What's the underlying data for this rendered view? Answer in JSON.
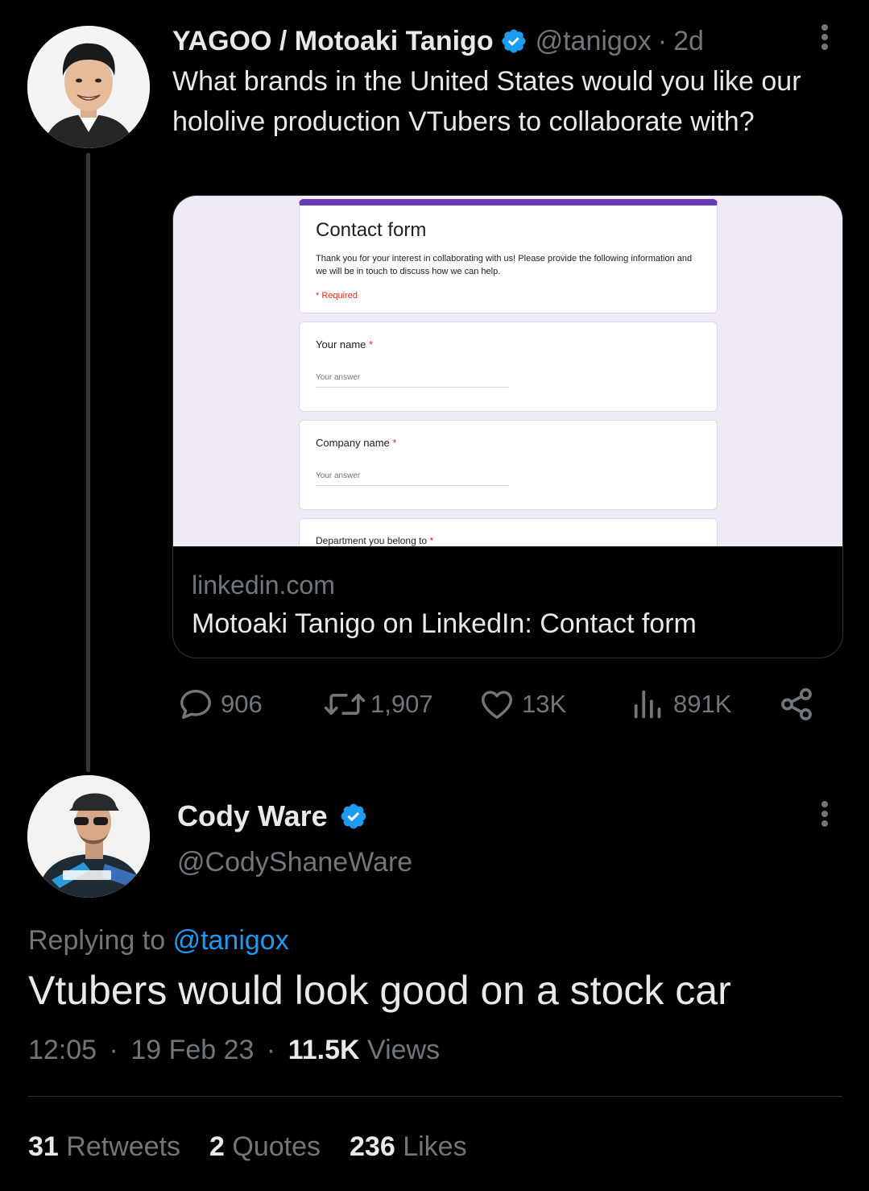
{
  "tweet": {
    "display_name": "YAGOO / Motoaki Tanigo",
    "handle": "@tanigox",
    "separator": "·",
    "age": "2d",
    "text": "What brands in the United States would you like our hololive production VTubers to collaborate with?",
    "card": {
      "form_title": "Contact form",
      "form_description": "Thank you for your interest in collaborating with us! Please provide the following information and we will be in touch to discuss how we can help.",
      "required_note": "* Required",
      "questions": [
        {
          "label": "Your name",
          "placeholder": "Your answer"
        },
        {
          "label": "Company name",
          "placeholder": "Your answer"
        },
        {
          "label": "Department you belong to",
          "placeholder": ""
        }
      ],
      "required_star": "*",
      "domain": "linkedin.com",
      "title": "Motoaki Tanigo on LinkedIn: Contact form"
    },
    "actions": {
      "replies": "906",
      "retweets": "1,907",
      "likes": "13K",
      "views": "891K"
    }
  },
  "reply": {
    "display_name": "Cody Ware",
    "handle": "@CodyShaneWare",
    "replying_prefix": "Replying to",
    "replying_to": "@tanigox",
    "text": "Vtubers would look good on a stock car",
    "time": "12:05",
    "date": "19 Feb 23",
    "dot": "·",
    "views_count": "11.5K",
    "views_label": "Views",
    "stats": [
      {
        "count": "31",
        "label": "Retweets"
      },
      {
        "count": "2",
        "label": "Quotes"
      },
      {
        "count": "236",
        "label": "Likes"
      }
    ]
  },
  "colors": {
    "background": "#000000",
    "text": "#e7e9ea",
    "secondary": "#71767b",
    "accent": "#1d9bf0",
    "form_accent": "#673ab7",
    "required": "#d93025"
  },
  "icons": [
    "verified-badge-icon",
    "more-icon",
    "reply-icon",
    "retweet-icon",
    "like-icon",
    "views-icon",
    "share-icon"
  ]
}
